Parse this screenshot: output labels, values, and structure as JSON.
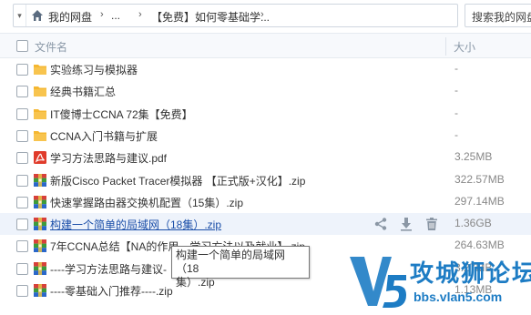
{
  "breadcrumb": {
    "root": "我的网盘",
    "ellipsis": "...",
    "current": "【免费】如何零基础学..."
  },
  "search": {
    "placeholder": "搜索我的网盘"
  },
  "header": {
    "name_label": "文件名",
    "size_label": "大小"
  },
  "files": [
    {
      "name": "实验练习与模拟器",
      "size": "-",
      "type": "folder-icon"
    },
    {
      "name": "经典书籍汇总",
      "size": "-",
      "type": "folder-icon"
    },
    {
      "name": "IT傻博士CCNA 72集【免费】",
      "size": "-",
      "type": "folder-icon"
    },
    {
      "name": "CCNA入门书籍与扩展",
      "size": "-",
      "type": "folder-icon"
    },
    {
      "name": "学习方法思路与建议.pdf",
      "size": "3.25MB",
      "type": "pdf-icon"
    },
    {
      "name": "新版Cisco Packet Tracer模拟器 【正式版+汉化】.zip",
      "size": "322.57MB",
      "type": "zip-icon"
    },
    {
      "name": "快速掌握路由器交换机配置（15集）.zip",
      "size": "297.14MB",
      "type": "zip-icon"
    },
    {
      "name": "构建一个简单的局域网（18集）.zip",
      "size": "1.36GB",
      "type": "zip-icon"
    },
    {
      "name": "7年CCNA总结【NA的作用、学习方法以及就业】.zip",
      "size": "264.63MB",
      "type": "zip-icon"
    },
    {
      "name": "----学习方法思路与建议-",
      "size": "3.27MB",
      "type": "zip-icon"
    },
    {
      "name": "----零基础入门推荐----.zip",
      "size": "1.13MB",
      "type": "zip-icon"
    }
  ],
  "tooltip": {
    "line1": "构建一个简单的局域网（18",
    "line2": "集）.zip"
  },
  "watermark": {
    "title": "攻城狮论坛",
    "url": "bbs.vlan5.com",
    "logo_text": "V5"
  },
  "colors": {
    "folder": "#f5b731",
    "pdf": "#e03b2b",
    "zip_red": "#d8403a",
    "zip_green": "#3b9b3b",
    "zip_blue": "#2a67c9",
    "accent": "#1d7cc4",
    "hover_bg": "#eef3fb"
  }
}
